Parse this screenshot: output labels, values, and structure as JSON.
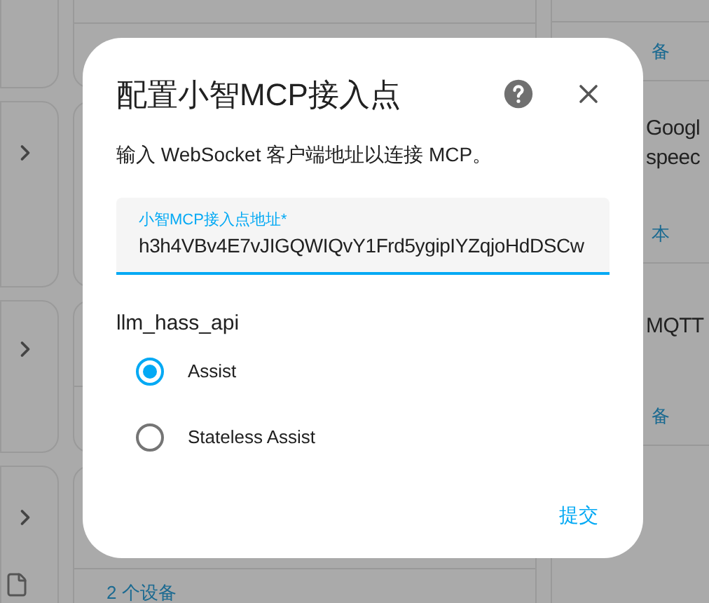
{
  "background": {
    "right_column": [
      {
        "kind": "link",
        "text": "备"
      },
      {
        "kind": "title",
        "text": "Googl\nspeec"
      },
      {
        "kind": "link",
        "text": "本"
      },
      {
        "kind": "title",
        "text": "MQTT"
      },
      {
        "kind": "link",
        "text": "备"
      }
    ],
    "middle_footer": "2 个设备"
  },
  "dialog": {
    "title": "配置小智MCP接入点",
    "description": "输入 WebSocket 客户端地址以连接 MCP。",
    "field": {
      "label": "小智MCP接入点地址*",
      "value": "h3h4VBv4E7vJIGQWIQvY1Frd5ygipIYZqjoHdDSCw"
    },
    "group_label": "llm_hass_api",
    "options": [
      {
        "label": "Assist",
        "selected": true
      },
      {
        "label": "Stateless Assist",
        "selected": false
      }
    ],
    "submit": "提交"
  }
}
